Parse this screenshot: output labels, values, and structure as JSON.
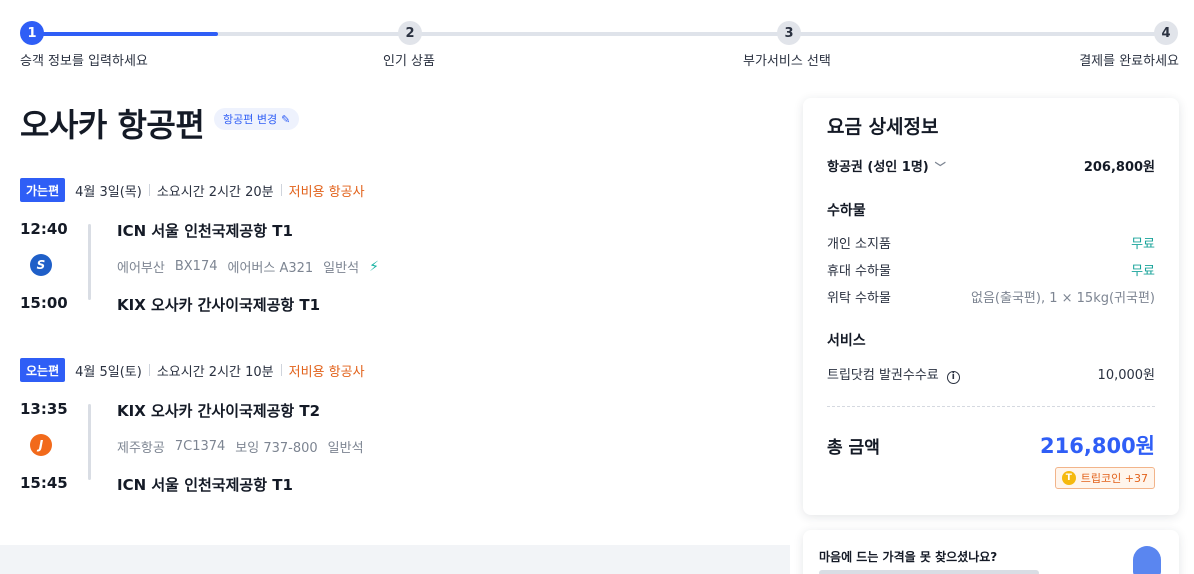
{
  "stepper": {
    "steps": [
      {
        "num": "1",
        "label": "승객 정보를 입력하세요"
      },
      {
        "num": "2",
        "label": "인기 상품"
      },
      {
        "num": "3",
        "label": "부가서비스 선택"
      },
      {
        "num": "4",
        "label": "결제를 완료하세요"
      }
    ],
    "progress": 0.07
  },
  "header": {
    "title": "오사카 항공편",
    "change_label": "항공편 변경",
    "change_icon": "pencil-icon"
  },
  "outbound": {
    "badge": "가는편",
    "date": "4월 3일(목)",
    "duration": "소요시간 2시간 20분",
    "carrier_type": "저비용 항공사",
    "dep_time": "12:40",
    "arr_time": "15:00",
    "dep_airport": "ICN 서울 인천국제공항 T1",
    "arr_airport": "KIX 오사카 간사이국제공항 T1",
    "airline": "에어부산",
    "flight_no": "BX174",
    "aircraft": "에어버스 A321",
    "cabin": "일반석",
    "logo_color": "#1f5fc8"
  },
  "inbound": {
    "badge": "오는편",
    "date": "4월 5일(토)",
    "duration": "소요시간 2시간 10분",
    "carrier_type": "저비용 항공사",
    "dep_time": "13:35",
    "arr_time": "15:45",
    "dep_airport": "KIX 오사카 간사이국제공항 T2",
    "arr_airport": "ICN 서울 인천국제공항 T1",
    "airline": "제주항공",
    "flight_no": "7C1374",
    "aircraft": "보잉 737-800",
    "cabin": "일반석",
    "logo_color": "#f26a1b"
  },
  "fare": {
    "title": "요금 상세정보",
    "ticket_label": "항공권 (성인 1명)",
    "ticket_value": "206,800원",
    "baggage_title": "수하물",
    "baggage": [
      {
        "label": "개인 소지품",
        "value": "무료"
      },
      {
        "label": "휴대 수하물",
        "value": "무료"
      },
      {
        "label": "위탁 수하물",
        "value": "없음(출국편), 1 × 15kg(귀국편)"
      }
    ],
    "service_title": "서비스",
    "service_label": "트립닷컴 발권수수료",
    "service_value": "10,000원",
    "total_label": "총 금액",
    "total_value": "216,800원",
    "coin_label": "트립코인 +37"
  },
  "promo": {
    "text": "마음에 드는 가격을 못 찾으셨나요?"
  },
  "colors": {
    "accent": "#2f5ef6",
    "lcc": "#e2621b",
    "free": "#19a39a"
  }
}
